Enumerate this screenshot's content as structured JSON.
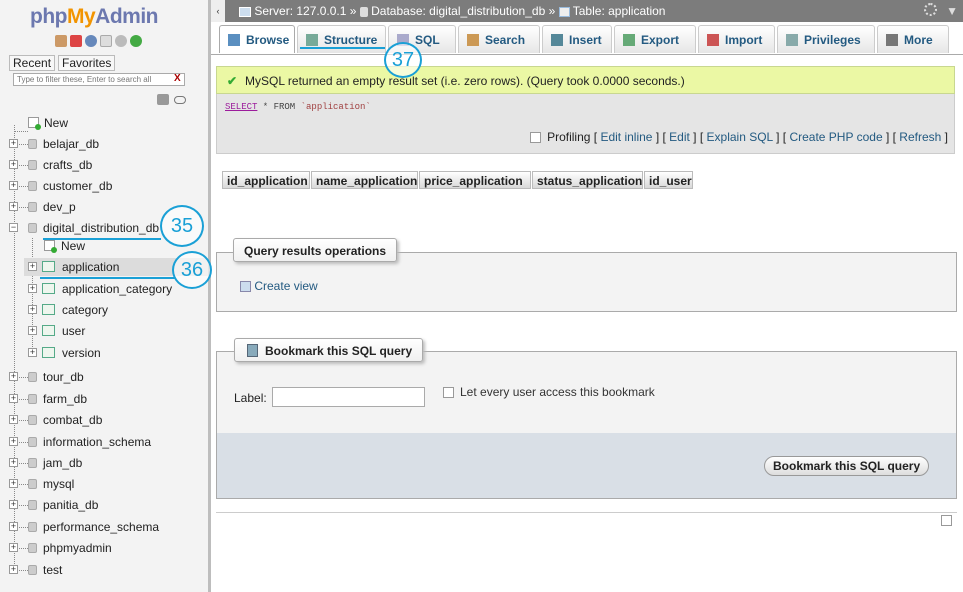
{
  "logo": {
    "php": "php",
    "my": "My",
    "admin": "Admin"
  },
  "nav": {
    "recent": "Recent",
    "favorites": "Favorites",
    "filter_placeholder": "Type to filter these, Enter to search all",
    "filter_clear": "X",
    "new_label": "New",
    "databases_before": [
      "belajar_db",
      "crafts_db",
      "customer_db",
      "dev_p"
    ],
    "current_db": "digital_distribution_db",
    "tables_new": "New",
    "tables": [
      "application",
      "application_category",
      "category",
      "user",
      "version"
    ],
    "databases_after": [
      "tour_db",
      "farm_db",
      "combat_db",
      "information_schema",
      "jam_db",
      "mysql",
      "panitia_db",
      "performance_schema",
      "phpmyadmin",
      "test"
    ]
  },
  "topbar": {
    "back": "‹",
    "server": "Server: 127.0.0.1",
    "sep": "»",
    "database": "Database: digital_distribution_db",
    "table": "Table: application",
    "menu_arrow": "▼"
  },
  "tabs": [
    "Browse",
    "Structure",
    "SQL",
    "Search",
    "Insert",
    "Export",
    "Import",
    "Privileges",
    "More"
  ],
  "message": "MySQL returned an empty result set (i.e. zero rows). (Query took 0.0000 seconds.)",
  "query": {
    "select": "SELECT",
    "rest": " * FROM ",
    "table": "`application`"
  },
  "query_links": {
    "profiling": "Profiling",
    "edit_inline": "Edit inline",
    "edit": "Edit",
    "explain": "Explain SQL",
    "php": "Create PHP code",
    "refresh": "Refresh"
  },
  "columns": [
    "id_application",
    "name_application",
    "price_application",
    "status_application",
    "id_user"
  ],
  "ops": {
    "legend": "Query results operations",
    "create_view": "Create view"
  },
  "bookmark": {
    "legend": "Bookmark this SQL query",
    "label": "Label:",
    "label_value": "",
    "share": "Let every user access this bookmark",
    "button": "Bookmark this SQL query"
  },
  "annotations": [
    "35",
    "36",
    "37"
  ],
  "colors": {
    "accent": "#235a81",
    "annotation": "#1aa0d6",
    "success_bg": "#ebf8a4"
  }
}
